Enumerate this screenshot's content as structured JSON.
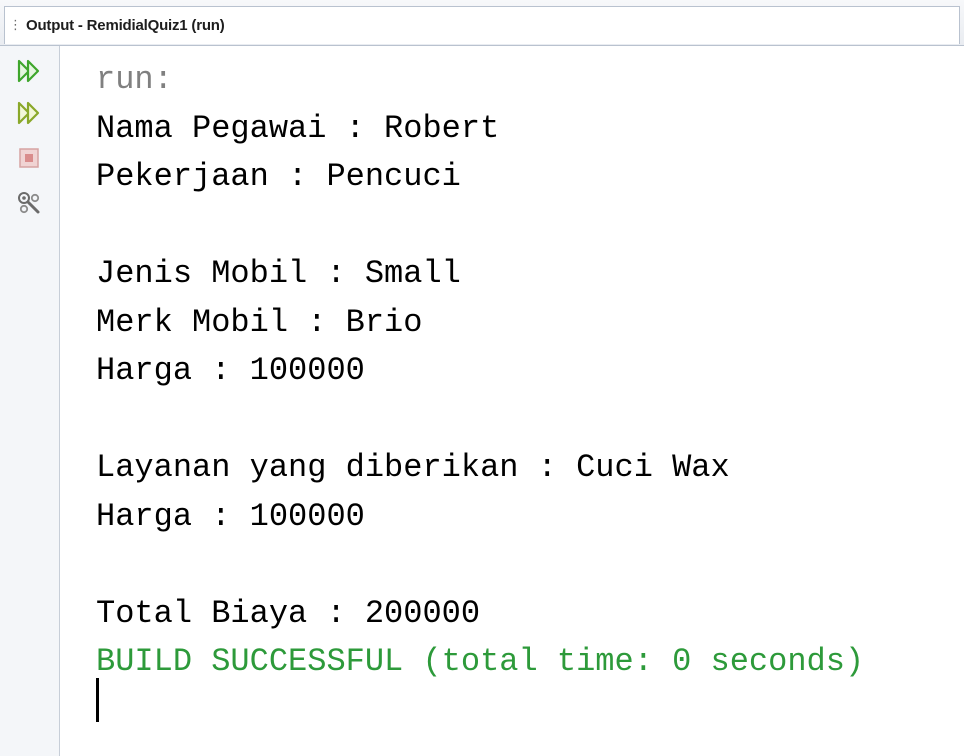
{
  "window": {
    "tab_title": "Output - RemidialQuiz1 (run)"
  },
  "toolbar": {
    "buttons": [
      {
        "icon": "rerun-icon",
        "color": "#3ea62c"
      },
      {
        "icon": "rerun-with-params-icon",
        "color": "#3ea62c"
      },
      {
        "icon": "stop-icon",
        "color": "#c84c4c"
      },
      {
        "icon": "settings-wrench-icon",
        "color": "#6b6b6b"
      }
    ]
  },
  "console": {
    "lines": [
      {
        "text": "run:",
        "style": "gray"
      },
      {
        "text": "Nama Pegawai : Robert",
        "style": "normal"
      },
      {
        "text": "Pekerjaan : Pencuci",
        "style": "normal"
      },
      {
        "text": "",
        "style": "normal"
      },
      {
        "text": "Jenis Mobil : Small",
        "style": "normal"
      },
      {
        "text": "Merk Mobil : Brio",
        "style": "normal"
      },
      {
        "text": "Harga : 100000",
        "style": "normal"
      },
      {
        "text": "",
        "style": "normal"
      },
      {
        "text": "Layanan yang diberikan : Cuci Wax",
        "style": "normal"
      },
      {
        "text": "Harga : 100000",
        "style": "normal"
      },
      {
        "text": "",
        "style": "normal"
      },
      {
        "text": "Total Biaya : 200000",
        "style": "normal"
      },
      {
        "text": "BUILD SUCCESSFUL (total time: 0 seconds)",
        "style": "green"
      }
    ]
  },
  "colors": {
    "success_green": "#2d9a3a",
    "run_gray": "#808080"
  }
}
